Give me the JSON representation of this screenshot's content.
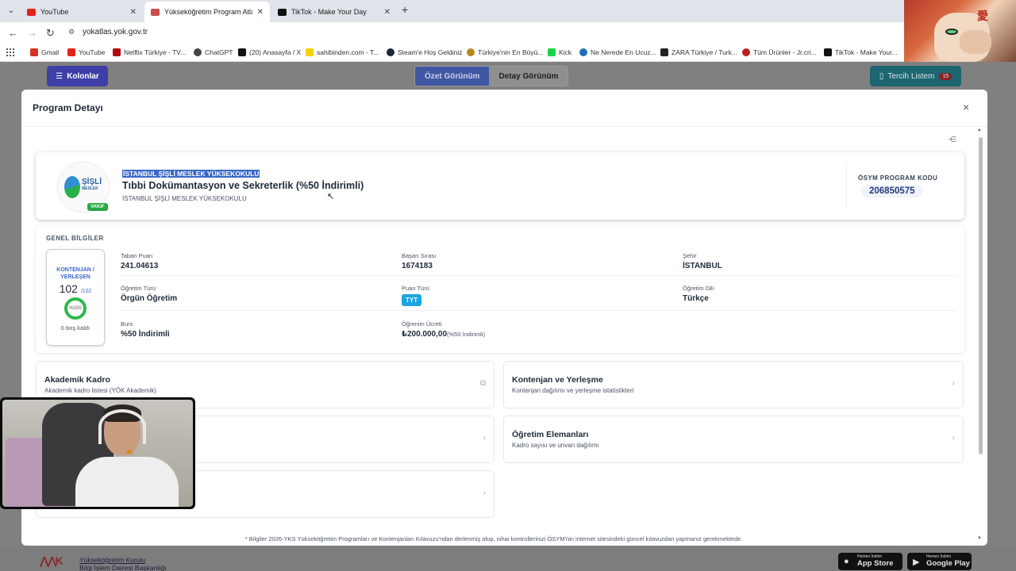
{
  "browser": {
    "tabs": [
      {
        "label": "YouTube",
        "favicon_color": "#e62117",
        "active": false
      },
      {
        "label": "Yükseköğretim Program Atlası",
        "favicon_color": "#c94c4c",
        "active": true
      },
      {
        "label": "TikTok - Make Your Day",
        "favicon_color": "#111111",
        "active": false
      }
    ],
    "new_tab": "+",
    "url": "yokatlas.yok.gov.tr",
    "bookmarks": [
      {
        "label": "Gmail",
        "color": "#d93025"
      },
      {
        "label": "YouTube",
        "color": "#e62117"
      },
      {
        "label": "Netflix Türkiye - TV...",
        "color": "#b20710"
      },
      {
        "label": "ChatGPT",
        "color": "#444444"
      },
      {
        "label": "(20) Anasayfa / X",
        "color": "#111111"
      },
      {
        "label": "sahibinden.com - T...",
        "color": "#f4d10a"
      },
      {
        "label": "Steam'e Hoş Geldiniz",
        "color": "#1b2838"
      },
      {
        "label": "Türkiye'nin En Büyü...",
        "color": "#b7871f"
      },
      {
        "label": "Kick",
        "color": "#1bd14a"
      },
      {
        "label": "Ne Nerede En Ucuz...",
        "color": "#1f6fb2"
      },
      {
        "label": "ZARA Türkiye / Turk...",
        "color": "#222222"
      },
      {
        "label": "Tüm Ürünler - Jr.cri...",
        "color": "#c02020"
      },
      {
        "label": "TikTok - Make Your...",
        "color": "#111111"
      }
    ]
  },
  "toolbar": {
    "kolonlar": "Kolonlar",
    "ozet": "Özet Görünüm",
    "detay": "Detay Görünüm",
    "tercih": "Tercih Listem",
    "tercih_count": "15"
  },
  "modal": {
    "title": "Program Detayı",
    "close": "×",
    "header": {
      "logo_text": "ŞİŞLİ",
      "logo_sub": "MESLEK",
      "badge": "VAKIF",
      "university": "İSTANBUL ŞİŞLİ MESLEK YÜKSEKOKULU",
      "program": "Tıbbi Dokümantasyon ve Sekreterlik (%50 İndirimli)",
      "university_sub": "İSTANBUL ŞİŞLİ MESLEK YÜKSEKOKULU",
      "code_label": "ÖSYM PROGRAM KODU",
      "code": "206850575"
    },
    "general": {
      "heading": "GENEL BİLGİLER",
      "kontenjan_label": "KONTENJAN / YERLEŞEN",
      "kontenjan_value": "102",
      "kontenjan_total": "/102",
      "fill_percent_label": "%100",
      "bos": "0 boş kaldı",
      "fields": {
        "taban_label": "Taban Puan",
        "taban": "241.04613",
        "basari_label": "Başarı Sırası",
        "basari": "1674183",
        "sehir_label": "Şehir",
        "sehir": "İSTANBUL",
        "ogretim_turu_label": "Öğretim Türü",
        "ogretim_turu": "Örgün Öğretim",
        "puan_turu_label": "Puan Türü",
        "puan_turu": "TYT",
        "dil_label": "Öğretim Dili",
        "dil": "Türkçe",
        "burs_label": "Burs",
        "burs": "%50 İndirimli",
        "ucret_label": "Öğrenim Ücreti",
        "ucret": "₺200.000,00",
        "ucret_note": "(%50 İndirimli)"
      }
    },
    "links": [
      {
        "title": "Akademik Kadro",
        "desc": "Akademik kadro listesi (YÖK Akademik)",
        "icon": "external-link-icon"
      },
      {
        "title": "Kontenjan ve Yerleşme",
        "desc": "Kontenjan dağılımı ve yerleşme istatistikleri",
        "icon": "chevron-right-icon"
      },
      {
        "title": "",
        "desc": "",
        "icon": "chevron-right-icon"
      },
      {
        "title": "Öğretim Elemanları",
        "desc": "Kadro sayısı ve unvan dağılımı",
        "icon": "chevron-right-icon"
      },
      {
        "title": "",
        "desc": "",
        "icon": "chevron-right-icon"
      }
    ],
    "footnote": "* Bilgiler 2026-YKS Yükseköğretim Programları ve Kontenjanları Kılavuzu'ndan derlenmiş olup, nihai kontrollerinizi ÖSYM'nin internet sitesindeki güncel kılavuzdan yapmanız gerekmektedir."
  },
  "footer": {
    "org": "Yükseköğretim Kurulu",
    "dept": "Bilgi İşlem Dairesi Başkanlığı",
    "app_store_small": "Hemen İndirin",
    "app_store": "App Store",
    "google_play_small": "Hemen İndirin",
    "google_play": "Google Play"
  },
  "colors": {
    "primary": "#3a67c9",
    "success": "#27a844",
    "info": "#1aa6e0"
  }
}
